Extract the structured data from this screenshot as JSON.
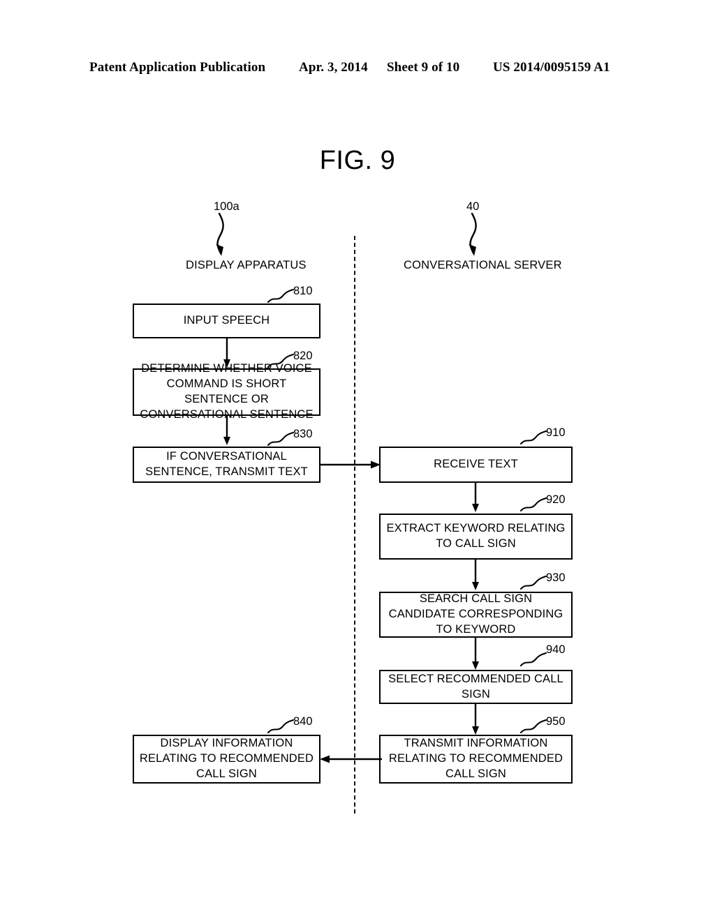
{
  "header": {
    "publication": "Patent Application Publication",
    "date": "Apr. 3, 2014",
    "sheet": "Sheet 9 of 10",
    "patent_number": "US 2014/0095159 A1"
  },
  "figure": {
    "title": "FIG. 9"
  },
  "lanes": {
    "left": {
      "ref": "100a",
      "label": "DISPLAY APPARATUS"
    },
    "right": {
      "ref": "40",
      "label": "CONVERSATIONAL SERVER"
    }
  },
  "steps": {
    "s810": {
      "ref": "810",
      "text": "INPUT SPEECH"
    },
    "s820": {
      "ref": "820",
      "text": "DETERMINE WHETHER VOICE COMMAND IS SHORT SENTENCE OR CONVERSATIONAL SENTENCE"
    },
    "s830": {
      "ref": "830",
      "text": "IF CONVERSATIONAL SENTENCE, TRANSMIT TEXT"
    },
    "s840": {
      "ref": "840",
      "text": "DISPLAY INFORMATION RELATING TO RECOMMENDED CALL SIGN"
    },
    "s910": {
      "ref": "910",
      "text": "RECEIVE TEXT"
    },
    "s920": {
      "ref": "920",
      "text": "EXTRACT KEYWORD RELATING TO CALL SIGN"
    },
    "s930": {
      "ref": "930",
      "text": "SEARCH CALL SIGN CANDIDATE CORRESPONDING TO KEYWORD"
    },
    "s940": {
      "ref": "940",
      "text": "SELECT RECOMMENDED CALL SIGN"
    },
    "s950": {
      "ref": "950",
      "text": "TRANSMIT INFORMATION RELATING TO RECOMMENDED CALL SIGN"
    }
  },
  "colors": {
    "ink": "#000000",
    "paper": "#ffffff"
  }
}
